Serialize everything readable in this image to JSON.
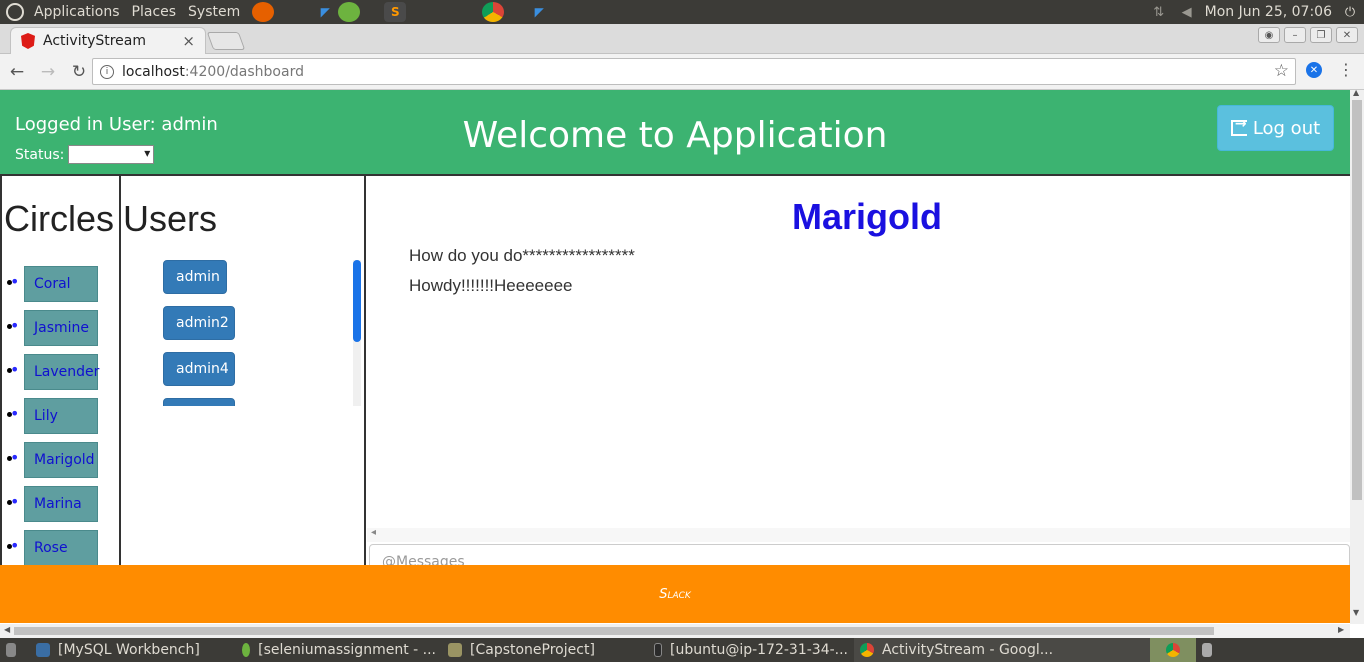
{
  "os_panel": {
    "menus": [
      "Applications",
      "Places",
      "System"
    ],
    "clock": "Mon Jun 25, 07:06"
  },
  "browser": {
    "tab_title": "ActivityStream",
    "tab_close": "×",
    "url_host": "localhost",
    "url_path": ":4200/dashboard"
  },
  "header": {
    "logged_user": "Logged in User: admin",
    "status_label": "Status:",
    "title": "Welcome to Application",
    "logout_label": "Log out"
  },
  "circles": {
    "heading": "Circles",
    "items": [
      "Coral",
      "Jasmine",
      "Lavender",
      "Lily",
      "Marigold",
      "Marina",
      "Rose"
    ]
  },
  "users": {
    "heading": "Users",
    "items": [
      "admin",
      "admin2",
      "admin4",
      ""
    ]
  },
  "chat": {
    "title": "Marigold",
    "messages": [
      "How do you do*****************",
      "Howdy!!!!!!!Heeeeeee"
    ],
    "input_placeholder": "@Messages"
  },
  "footer": {
    "text": "Slack"
  },
  "taskbar": {
    "tasks": [
      "[MySQL Workbench]",
      "[seleniumassignment - ...",
      "[CapstoneProject]",
      "[ubuntu@ip-172-31-34-...",
      "ActivityStream - Googl..."
    ]
  },
  "colors": {
    "header_green": "#3cb371",
    "footer_orange": "#ff8c00",
    "circle_teal": "#5f9ea0",
    "user_blue": "#337ab7",
    "logout_cyan": "#5bc0de",
    "chat_title": "#1a10e0"
  }
}
